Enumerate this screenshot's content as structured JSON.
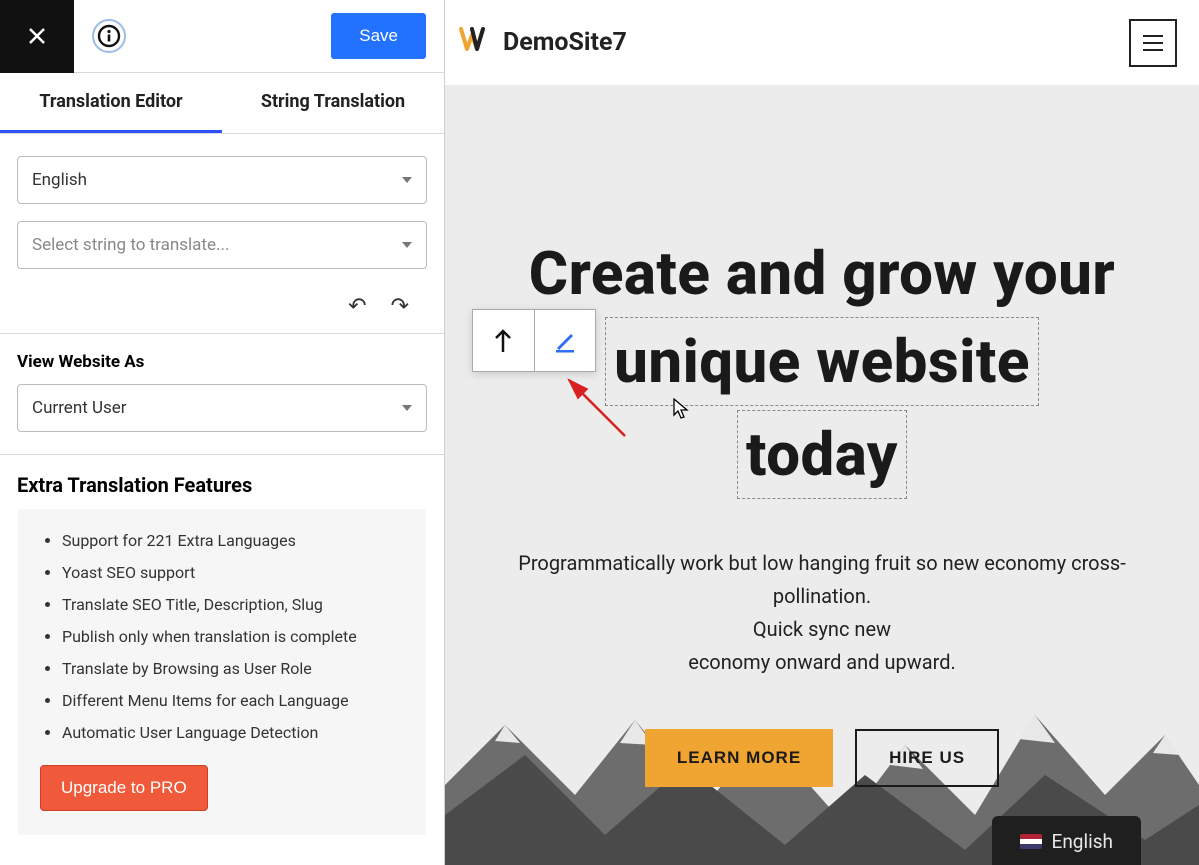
{
  "topbar": {
    "save_label": "Save"
  },
  "tabs": {
    "editor": "Translation Editor",
    "string": "String Translation"
  },
  "selects": {
    "language": "English",
    "string_placeholder": "Select string to translate..."
  },
  "view_as": {
    "title": "View Website As",
    "value": "Current User"
  },
  "extra": {
    "title": "Extra Translation Features",
    "items": [
      "Support for 221 Extra Languages",
      "Yoast SEO support",
      "Translate SEO Title, Description, Slug",
      "Publish only when translation is complete",
      "Translate by Browsing as User Role",
      "Different Menu Items for each Language",
      "Automatic User Language Detection"
    ],
    "upgrade_label": "Upgrade to PRO"
  },
  "site": {
    "logo_text": "W",
    "title": "DemoSite7"
  },
  "hero": {
    "heading_line1": "Create and grow your",
    "heading_line2": "unique website",
    "heading_line3": "today",
    "sub_line1": "Programmatically work but low hanging fruit so new economy cross-pollination.",
    "sub_line2": "Quick sync new",
    "sub_line3": "economy onward and upward.",
    "btn_primary": "LEARN MORE",
    "btn_outline": "HIRE US"
  },
  "lang_switcher": {
    "label": "English"
  }
}
